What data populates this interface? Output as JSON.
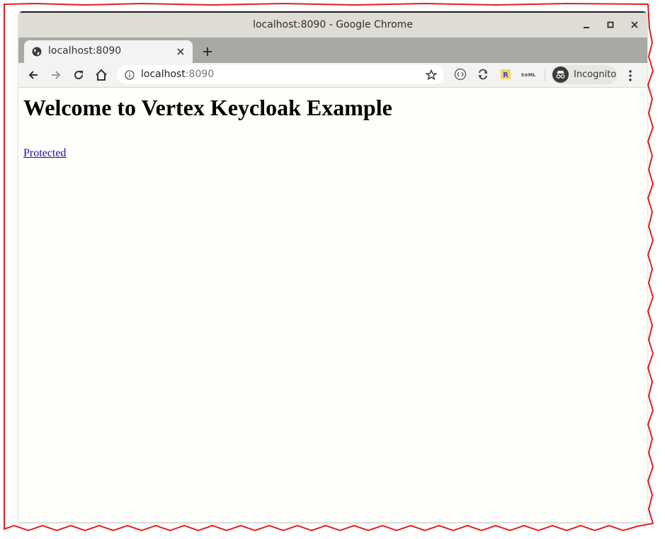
{
  "window": {
    "title": "localhost:8090 - Google Chrome"
  },
  "tab": {
    "title": "localhost:8090"
  },
  "omnibox": {
    "host": "localhost",
    "port": ":8090"
  },
  "toolbar": {
    "extensions": [
      "",
      "",
      "R",
      "S⊕ML"
    ],
    "incognito_label": "Incognito"
  },
  "page": {
    "heading": "Welcome to Vertex Keycloak Example",
    "link_text": "Protected"
  },
  "colors": {
    "frame": "#e02020",
    "link": "#1a0dab",
    "titlebar": "#dedcd5",
    "tabstrip": "#a8a8a4"
  }
}
